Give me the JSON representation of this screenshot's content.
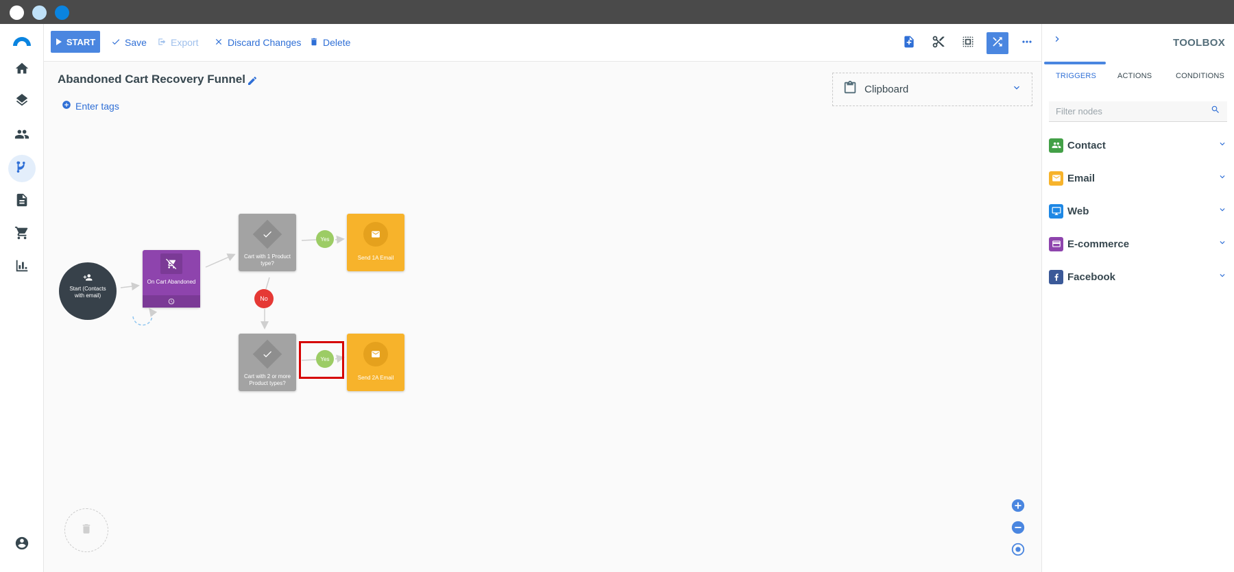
{
  "window": {
    "dots": [
      "#ffffff",
      "#bfe1f8",
      "#0a84e0"
    ]
  },
  "nav": {
    "items": [
      {
        "name": "home-icon"
      },
      {
        "name": "layers-icon"
      },
      {
        "name": "contacts-icon"
      },
      {
        "name": "workflow-icon",
        "active": true
      },
      {
        "name": "document-icon"
      },
      {
        "name": "cart-icon"
      },
      {
        "name": "analytics-icon"
      }
    ],
    "account": "account-icon"
  },
  "toolbar": {
    "start_label": "START",
    "save_label": "Save",
    "export_label": "Export",
    "discard_label": "Discard Changes",
    "delete_label": "Delete",
    "right_icons": [
      "add-node-icon",
      "scissors-icon",
      "select-area-icon",
      "auto-arrange-icon",
      "more-icon"
    ]
  },
  "workflow": {
    "title": "Abandoned Cart Recovery Funnel",
    "tags_label": "Enter tags"
  },
  "clipboard": {
    "label": "Clipboard"
  },
  "flow": {
    "start_node": "Start (Contacts with email)",
    "trigger_node": "On Cart Abandoned",
    "condition_1": "Cart with 1 Product type?",
    "condition_2": "Cart with 2 or more Product types?",
    "email_1": "Send 1A Email",
    "email_2": "Send 2A Email",
    "yes_label": "Yes",
    "no_label": "No"
  },
  "toolbox": {
    "title": "TOOLBOX",
    "tabs": [
      {
        "label": "TRIGGERS",
        "active": true
      },
      {
        "label": "ACTIONS"
      },
      {
        "label": "CONDITIONS"
      }
    ],
    "filter_placeholder": "Filter nodes",
    "categories": [
      {
        "label": "Contact",
        "color": "#43a047",
        "icon": "people-icon"
      },
      {
        "label": "Email",
        "color": "#f7b32b",
        "icon": "envelope-icon"
      },
      {
        "label": "Web",
        "color": "#1e88e5",
        "icon": "monitor-icon"
      },
      {
        "label": "E-commerce",
        "color": "#8e44ad",
        "icon": "credit-card-icon"
      },
      {
        "label": "Facebook",
        "color": "#3b5998",
        "icon": "facebook-icon"
      }
    ]
  },
  "colors": {
    "accent": "#2f6fd6",
    "start_button": "#4a86e0",
    "trigger": "#8e44ad",
    "condition": "#a3a3a3",
    "email": "#f7b32b",
    "yes": "#9ccc65",
    "no": "#e53935",
    "highlight": "#d50000"
  }
}
